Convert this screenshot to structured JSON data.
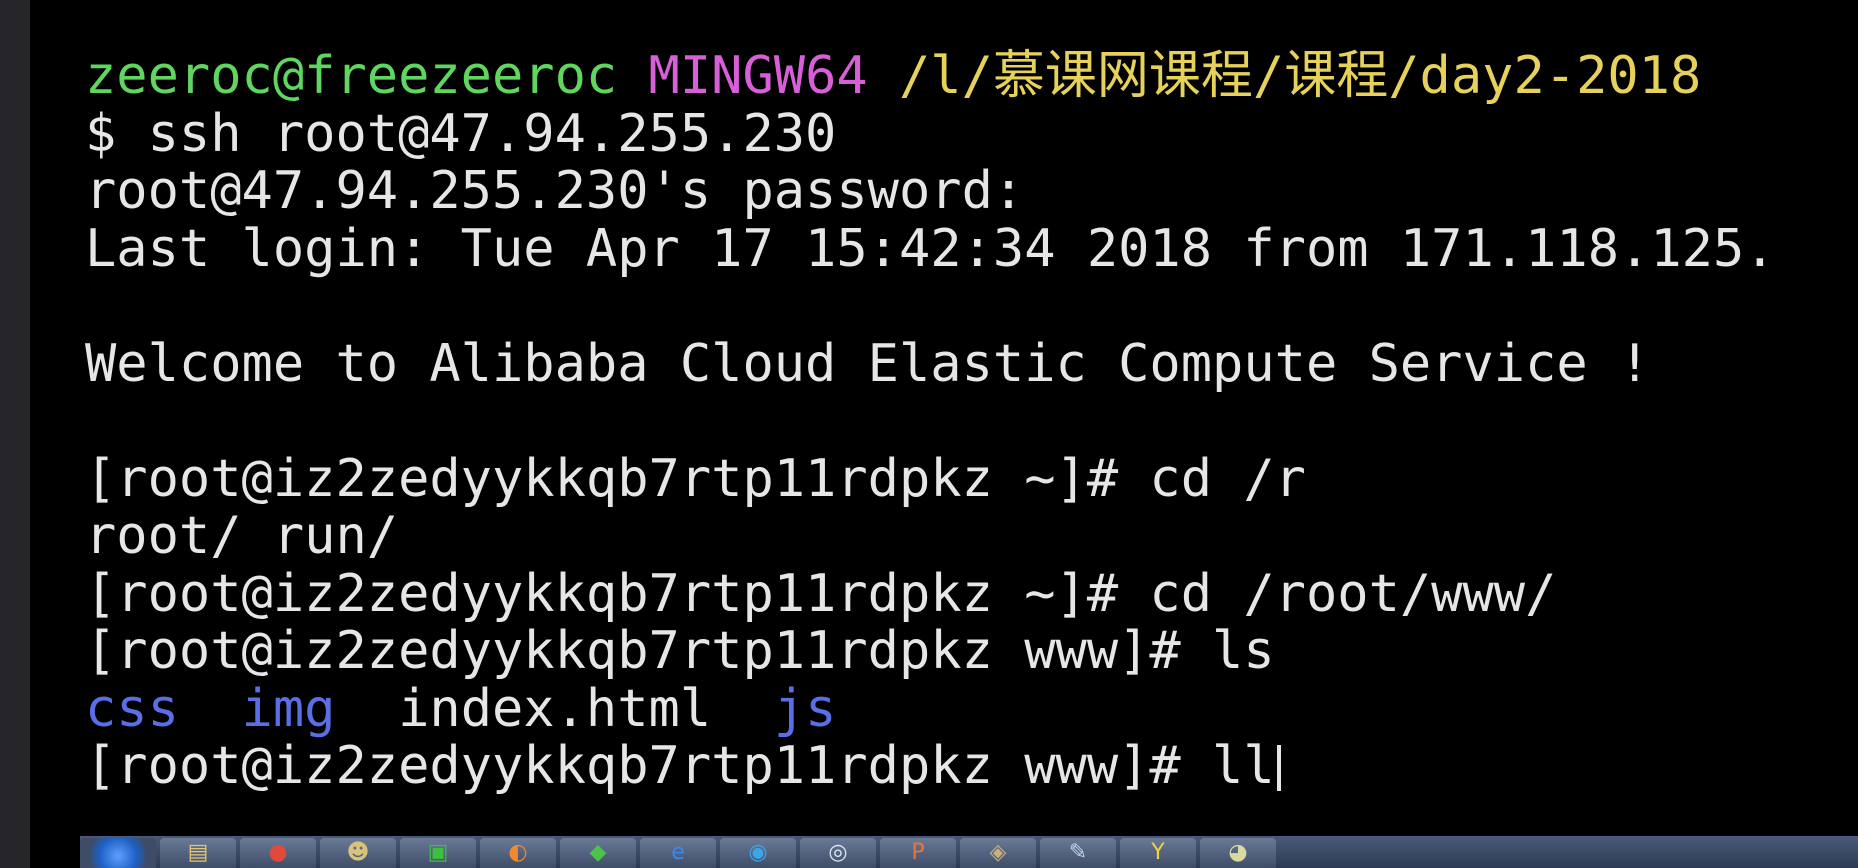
{
  "terminal": {
    "lines": [
      {
        "segments": [
          {
            "text": "zeeroc@freezeeroc",
            "color": "#5fd75f"
          },
          {
            "text": " "
          },
          {
            "text": "MINGW64",
            "color": "#d75fd7"
          },
          {
            "text": " "
          },
          {
            "text": "/l/慕课网课程/课程/day2-2018",
            "color": "#e6d25a"
          }
        ]
      },
      {
        "segments": [
          {
            "text": "$ ssh root@47.94.255.230"
          }
        ]
      },
      {
        "segments": [
          {
            "text": "root@47.94.255.230's password:"
          }
        ]
      },
      {
        "segments": [
          {
            "text": "Last login: Tue Apr 17 15:42:34 2018 from 171.118.125."
          }
        ]
      },
      {
        "segments": [
          {
            "text": ""
          }
        ]
      },
      {
        "segments": [
          {
            "text": "Welcome to Alibaba Cloud Elastic Compute Service !"
          }
        ]
      },
      {
        "segments": [
          {
            "text": ""
          }
        ]
      },
      {
        "segments": [
          {
            "text": "[root@iz2zedyykkqb7rtp11rdpkz ~]# cd /r"
          }
        ]
      },
      {
        "segments": [
          {
            "text": "root/ run/"
          }
        ]
      },
      {
        "segments": [
          {
            "text": "[root@iz2zedyykkqb7rtp11rdpkz ~]# cd /root/www/"
          }
        ]
      },
      {
        "segments": [
          {
            "text": "[root@iz2zedyykkqb7rtp11rdpkz www]# ls"
          }
        ]
      },
      {
        "segments": [
          {
            "text": "css",
            "color": "#5a6fe6"
          },
          {
            "text": "  "
          },
          {
            "text": "img",
            "color": "#5a6fe6"
          },
          {
            "text": "  index.html  "
          },
          {
            "text": "js",
            "color": "#5a6fe6"
          }
        ]
      },
      {
        "segments": [
          {
            "text": "[root@iz2zedyykkqb7rtp11rdpkz www]# ll"
          }
        ],
        "cursor": true
      }
    ]
  },
  "taskbar": {
    "items": [
      {
        "name": "start-button-icon",
        "glyph": "",
        "color": "#ffffff",
        "start": true
      },
      {
        "name": "folder-icon",
        "glyph": "▤",
        "color": "#e8c66a"
      },
      {
        "name": "chrome-icon",
        "glyph": "●",
        "color": "#e04a3a"
      },
      {
        "name": "app-icon",
        "glyph": "☻",
        "color": "#d9c27a"
      },
      {
        "name": "iqiyi-icon",
        "glyph": "▣",
        "color": "#3fbf3f"
      },
      {
        "name": "fox-icon",
        "glyph": "◐",
        "color": "#f08a2a"
      },
      {
        "name": "evernote-icon",
        "glyph": "◆",
        "color": "#4cc24c"
      },
      {
        "name": "ie-icon",
        "glyph": "e",
        "color": "#3a8ae6"
      },
      {
        "name": "qq-icon",
        "glyph": "◉",
        "color": "#3aa6e6"
      },
      {
        "name": "browser-icon",
        "glyph": "◎",
        "color": "#dfe6f0"
      },
      {
        "name": "powerpoint-icon",
        "glyph": "P",
        "color": "#e8753a"
      },
      {
        "name": "network-icon",
        "glyph": "◈",
        "color": "#c9b07a"
      },
      {
        "name": "pen-icon",
        "glyph": "✎",
        "color": "#bcd6f0"
      },
      {
        "name": "y-app-icon",
        "glyph": "Y",
        "color": "#f0d23a"
      },
      {
        "name": "misc-app-icon",
        "glyph": "◕",
        "color": "#d9d9a0"
      }
    ]
  }
}
